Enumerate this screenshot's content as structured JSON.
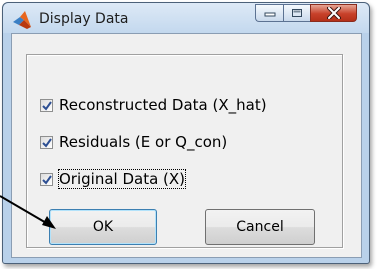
{
  "window": {
    "title": "Display Data",
    "icon": "matlab-icon",
    "caption_buttons": [
      "minimize-icon",
      "maximize-icon",
      "close-icon"
    ]
  },
  "options": [
    {
      "label": "Reconstructed Data (X_hat)",
      "checked": true
    },
    {
      "label": "Residuals (E or Q_con)",
      "checked": true
    },
    {
      "label": "Original Data (X)",
      "checked": true,
      "focused": true
    }
  ],
  "buttons": {
    "ok_label": "OK",
    "cancel_label": "Cancel"
  },
  "colors": {
    "check_mark": "#2d4f93",
    "close_button": "#c8412a",
    "arrow": "#000000"
  }
}
